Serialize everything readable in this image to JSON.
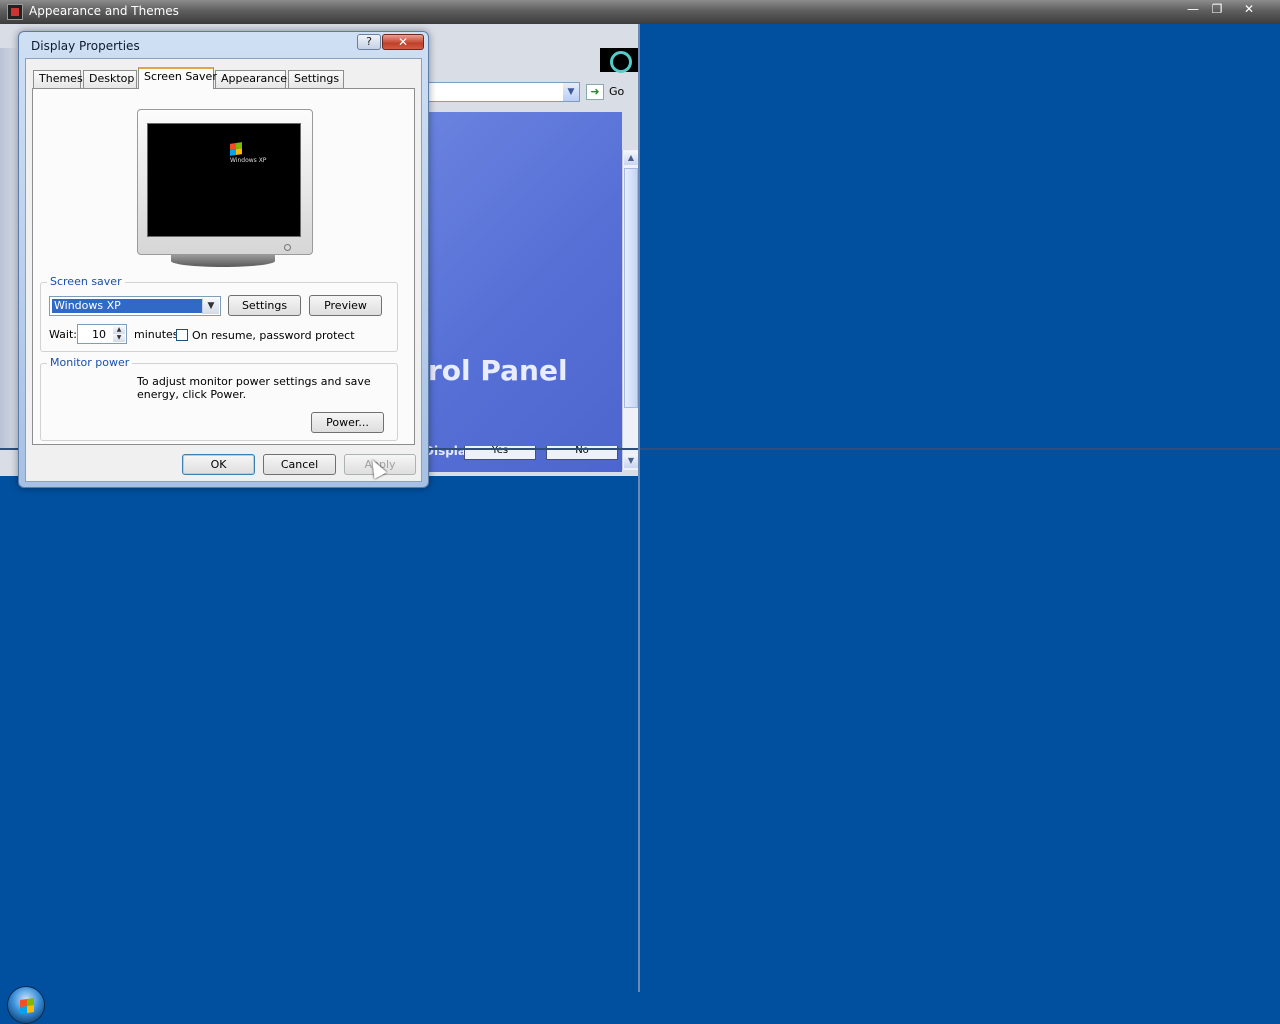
{
  "parent_window": {
    "title": "Appearance and Themes",
    "minimize_glyph": "—",
    "restore_glyph": "❐",
    "close_glyph": "✕"
  },
  "background_window": {
    "go_label": "Go",
    "cp_title": "rol Panel",
    "cp_subtitle": "Display",
    "yes_label": "Yes",
    "no_label": "No"
  },
  "dialog": {
    "title": "Display Properties",
    "help_glyph": "?",
    "close_glyph": "✕",
    "tabs": [
      {
        "label": "Themes",
        "active": false
      },
      {
        "label": "Desktop",
        "active": false
      },
      {
        "label": "Screen Saver",
        "active": true
      },
      {
        "label": "Appearance",
        "active": false
      },
      {
        "label": "Settings",
        "active": false
      }
    ],
    "preview_logo_text": "Windows XP",
    "screen_saver": {
      "legend": "Screen saver",
      "selected": "Windows XP",
      "settings_label": "Settings",
      "preview_label": "Preview",
      "wait_label": "Wait:",
      "wait_value": "10",
      "minutes_label": "minutes",
      "password_label": "On resume, password protect",
      "password_checked": false
    },
    "monitor_power": {
      "legend": "Monitor power",
      "description": "To adjust monitor power settings and save energy, click Power.",
      "power_label": "Power..."
    },
    "ok_label": "OK",
    "cancel_label": "Cancel",
    "apply_label": "Apply"
  },
  "colors": {
    "desktop": "#0150a0",
    "selection": "#3169c6",
    "legend_text": "#1b4fa8",
    "active_tab_accent": "#e4a44a"
  }
}
